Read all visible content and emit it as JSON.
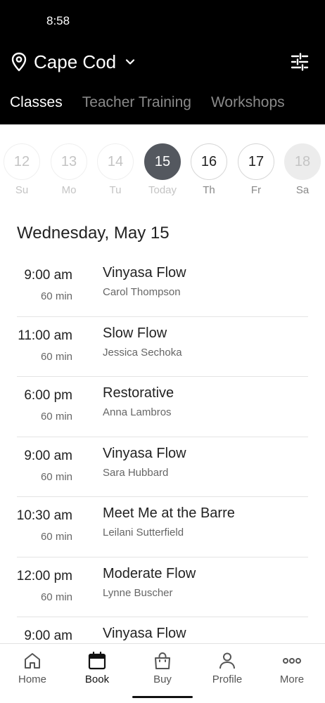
{
  "status": {
    "time": "8:58"
  },
  "header": {
    "location": "Cape Cod",
    "tabs": [
      {
        "label": "Classes",
        "active": true
      },
      {
        "label": "Teacher Training",
        "active": false
      },
      {
        "label": "Workshops",
        "active": false
      }
    ]
  },
  "days": [
    {
      "num": "12",
      "label": "Su",
      "state": "past"
    },
    {
      "num": "13",
      "label": "Mo",
      "state": "past"
    },
    {
      "num": "14",
      "label": "Tu",
      "state": "past"
    },
    {
      "num": "15",
      "label": "Today",
      "state": "selected"
    },
    {
      "num": "16",
      "label": "Th",
      "state": "normal"
    },
    {
      "num": "17",
      "label": "Fr",
      "state": "normal"
    },
    {
      "num": "18",
      "label": "Sa",
      "state": "disabled"
    }
  ],
  "schedule": {
    "date_heading": "Wednesday, May 15",
    "classes": [
      {
        "time": "9:00 am",
        "duration": "60 min",
        "name": "Vinyasa Flow",
        "teacher": "Carol Thompson"
      },
      {
        "time": "11:00 am",
        "duration": "60 min",
        "name": "Slow Flow",
        "teacher": "Jessica Sechoka"
      },
      {
        "time": "6:00 pm",
        "duration": "60 min",
        "name": "Restorative",
        "teacher": "Anna Lambros"
      },
      {
        "time": "9:00 am",
        "duration": "60 min",
        "name": "Vinyasa Flow",
        "teacher": "Sara Hubbard"
      },
      {
        "time": "10:30 am",
        "duration": "60 min",
        "name": "Meet Me at the Barre",
        "teacher": "Leilani Sutterfield"
      },
      {
        "time": "12:00 pm",
        "duration": "60 min",
        "name": "Moderate Flow",
        "teacher": "Lynne Buscher"
      },
      {
        "time": "9:00 am",
        "duration": "",
        "name": "Vinyasa Flow",
        "teacher": ""
      }
    ]
  },
  "nav": {
    "home": "Home",
    "book": "Book",
    "buy": "Buy",
    "profile": "Profile",
    "more": "More"
  },
  "icons": {
    "location": "location-pin-icon",
    "dropdown": "chevron-down-icon",
    "filters": "sliders-icon"
  }
}
